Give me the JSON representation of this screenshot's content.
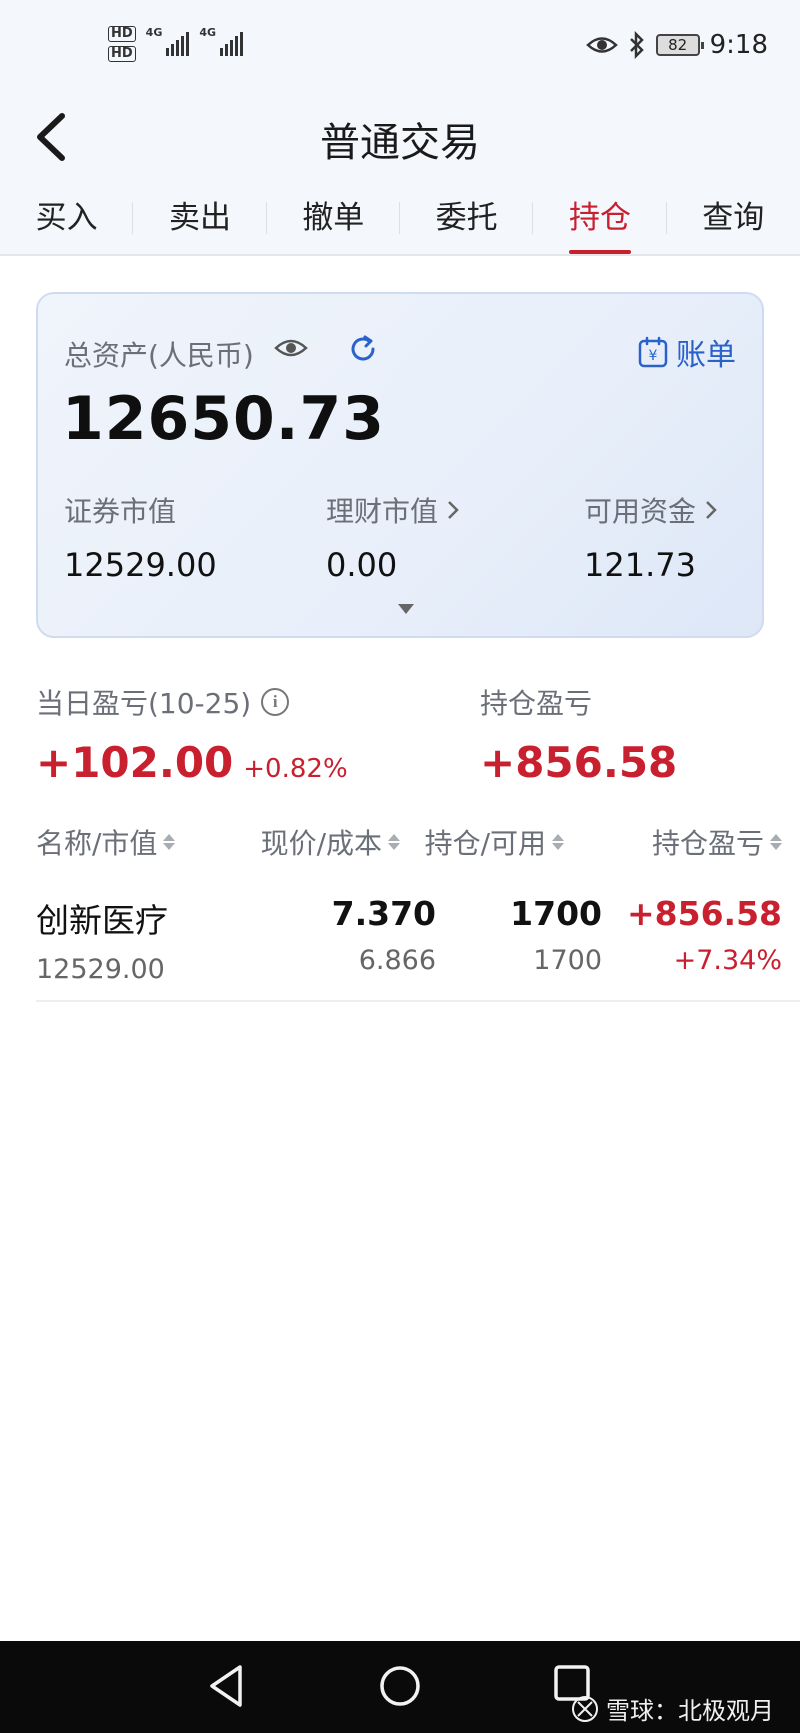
{
  "status_bar": {
    "sim1": "HD",
    "sim2": "HD",
    "net1": "4G",
    "net2": "4G",
    "battery": "82",
    "time": "9:18"
  },
  "header": {
    "title": "普通交易"
  },
  "tabs": [
    {
      "label": "买入"
    },
    {
      "label": "卖出"
    },
    {
      "label": "撤单"
    },
    {
      "label": "委托"
    },
    {
      "label": "持仓",
      "active": true
    },
    {
      "label": "查询"
    }
  ],
  "assets": {
    "total_label": "总资产(人民币)",
    "bill_label": "账单",
    "total_value": "12650.73",
    "securities_label": "证券市值",
    "securities_value": "12529.00",
    "wealth_label": "理财市值",
    "wealth_value": "0.00",
    "available_label": "可用资金",
    "available_value": "121.73"
  },
  "pnl": {
    "daily_label": "当日盈亏(10-25)",
    "daily_value": "+102.00",
    "daily_pct": "+0.82%",
    "holding_label": "持仓盈亏",
    "holding_value": "+856.58"
  },
  "table": {
    "headers": [
      "名称/市值",
      "现价/成本",
      "持仓/可用",
      "持仓盈亏"
    ],
    "rows": [
      {
        "name": "创新医疗",
        "market_value": "12529.00",
        "price": "7.370",
        "cost": "6.866",
        "position": "1700",
        "available": "1700",
        "pnl": "+856.58",
        "pnl_pct": "+7.34%"
      }
    ]
  },
  "watermark": "雪球：北极观月",
  "colors": {
    "accent_red": "#c8202f",
    "link_blue": "#2a62c9",
    "header_bg": "#f4f7fc"
  }
}
